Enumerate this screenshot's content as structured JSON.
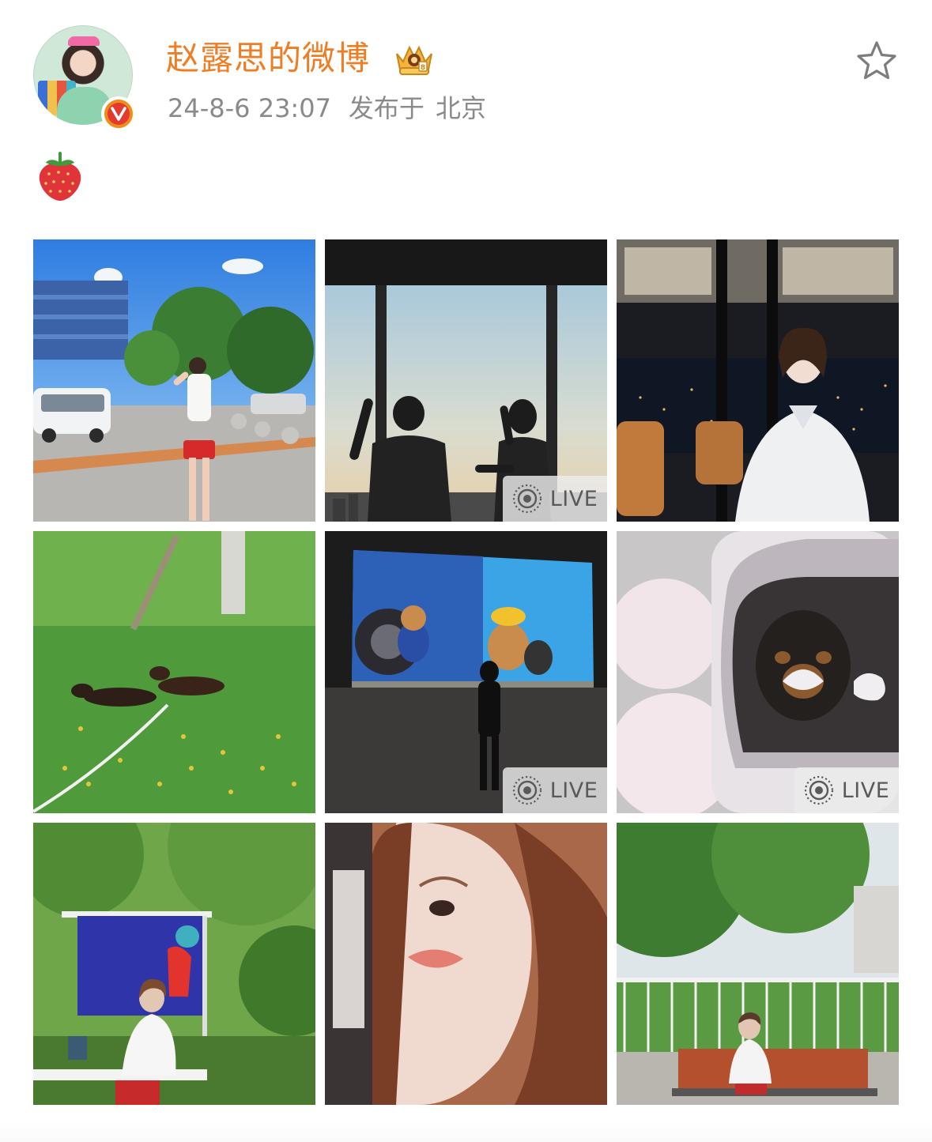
{
  "post": {
    "author_name": "赵露思的微博",
    "timestamp": "24-8-6 23:07",
    "location_prefix": "发布于",
    "location": "北京",
    "content_emoji": "strawberry-emoji",
    "favorite_icon": "star-outline-icon",
    "verified_icon": "verified-v-icon",
    "member_icon": "crown-member-icon"
  },
  "images": [
    {
      "name": "photo-street-red-shorts",
      "live": false
    },
    {
      "name": "photo-window-silhouettes",
      "live": true
    },
    {
      "name": "photo-night-office-portrait",
      "live": false
    },
    {
      "name": "photo-dachshunds-grass",
      "live": false
    },
    {
      "name": "photo-projection-cartoon",
      "live": true
    },
    {
      "name": "photo-dog-pet-carrier",
      "live": true
    },
    {
      "name": "photo-paris-2024-banner",
      "live": false
    },
    {
      "name": "photo-selfie-closeup",
      "live": false
    },
    {
      "name": "photo-bench-garden",
      "live": false
    }
  ],
  "live_label": "LIVE",
  "colors": {
    "author_name": "#ee7d24",
    "meta_text": "#8a8a8a",
    "verified_badge": "#f08c1a"
  }
}
